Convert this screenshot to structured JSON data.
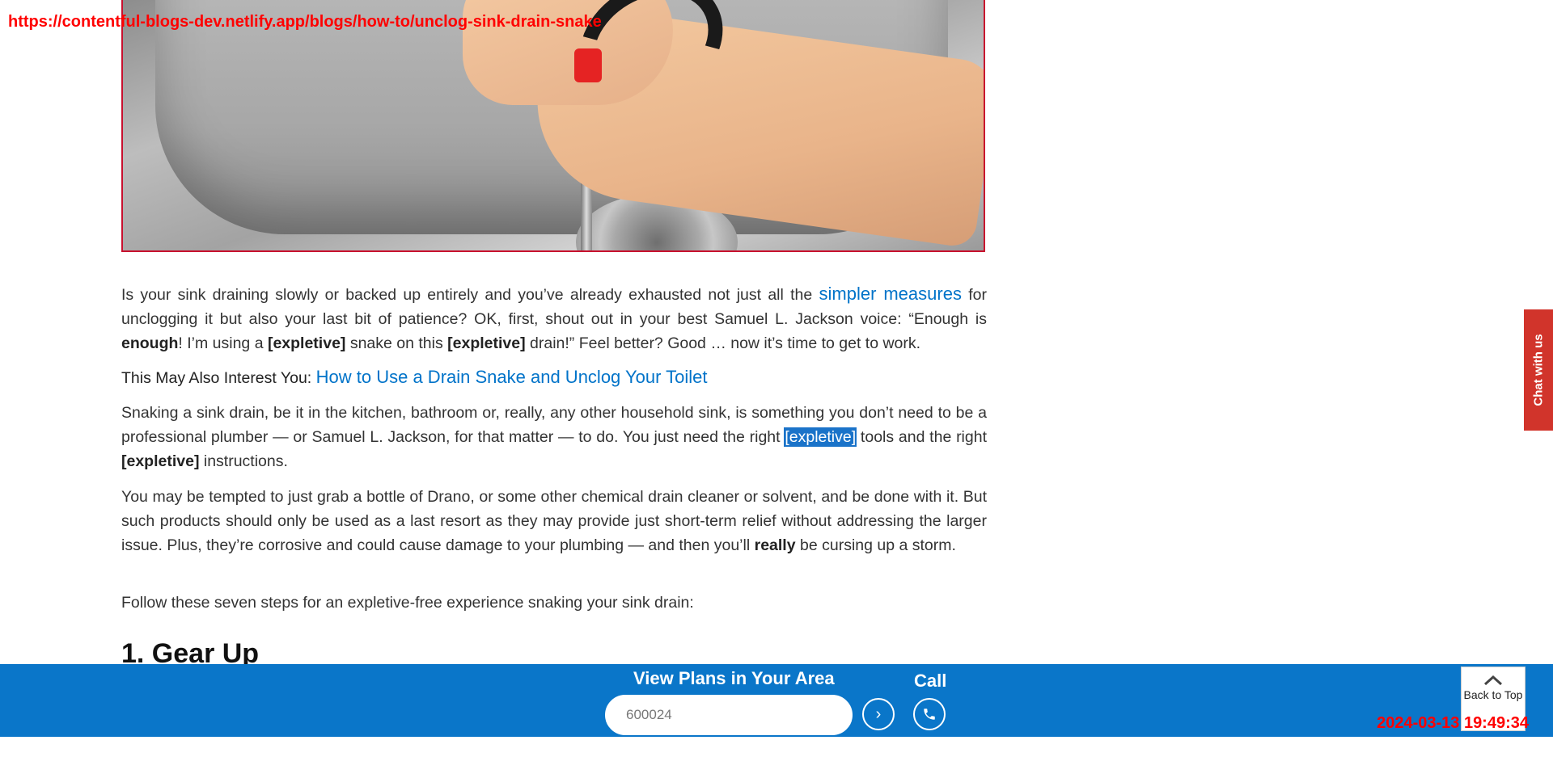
{
  "overlay": {
    "url": "https://contentful-blogs-dev.netlify.app/blogs/how-to/unclog-sink-drain-snake",
    "timestamp": "2024-03-13 19:49:34"
  },
  "article": {
    "p1": {
      "t1": "Is your sink draining slowly or backed up entirely and you’ve already exhausted not just all the ",
      "link": "simpler measures",
      "t2": " for unclogging it but also your last bit of patience? OK, first, shout out in your best Samuel L. Jackson voice: “Enough is ",
      "b1": "enough",
      "t3": "! I’m using a ",
      "b2": "[expletive]",
      "t4": " snake on this ",
      "b3": "[expletive]",
      "t5": " drain!” Feel better? Good … now it’s time to get to work."
    },
    "interest": {
      "label": "This May Also Interest You:",
      "link": "How to Use a Drain Snake and Unclog Your Toilet"
    },
    "p2": {
      "t1": "Snaking a sink drain, be it in the kitchen, bathroom or, really, any other household sink, is something you don’t need to be a professional plumber — or Samuel L. Jackson, for that matter — to do. You just need the right ",
      "hl": "[expletive]",
      "t2": " tools and the right ",
      "b1": "[expletive]",
      "t3": " instructions."
    },
    "p3": {
      "t1": "You may be tempted to just grab a bottle of Drano, or some other chemical drain cleaner or solvent, and be done with it. But such products should only be used as a last resort as they may provide just short-term relief without addressing the larger issue. Plus, they’re corrosive and could cause damage to your plumbing — and then you’ll ",
      "b1": "really",
      "t2": " be cursing up a storm."
    },
    "p4": "Follow these seven steps for an expletive-free experience snaking your sink drain:",
    "h2": "1. Gear Up"
  },
  "bottom_bar": {
    "view_label": "View Plans in Your Area",
    "zip_value": "600024",
    "call_label": "Call"
  },
  "back_to_top": "Back to Top",
  "chat_tab": "Chat with us",
  "colors": {
    "bar_blue": "#0a76c9",
    "link_blue": "#0073c9",
    "chat_red": "#d1342b",
    "overlay_red": "#ff0000"
  }
}
